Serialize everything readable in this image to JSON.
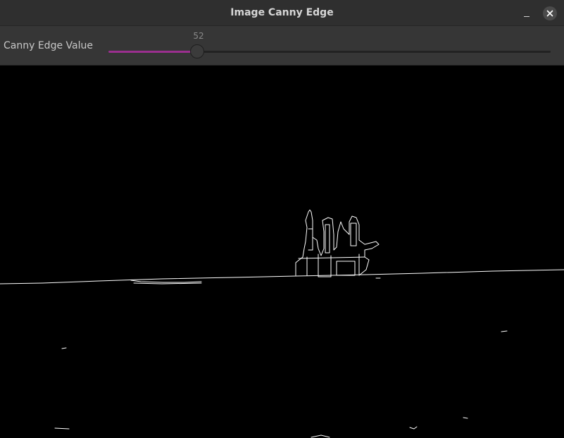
{
  "window": {
    "title": "Image Canny Edge"
  },
  "icons": {
    "minimize": "minimize-icon",
    "close": "close-icon"
  },
  "trackbar": {
    "label": "Canny Edge Value",
    "value": "52",
    "fill_fraction": 0.2,
    "accent_color": "#9b2f8f"
  },
  "canvas": {
    "background": "#000000",
    "edge_color": "#ffffff"
  }
}
